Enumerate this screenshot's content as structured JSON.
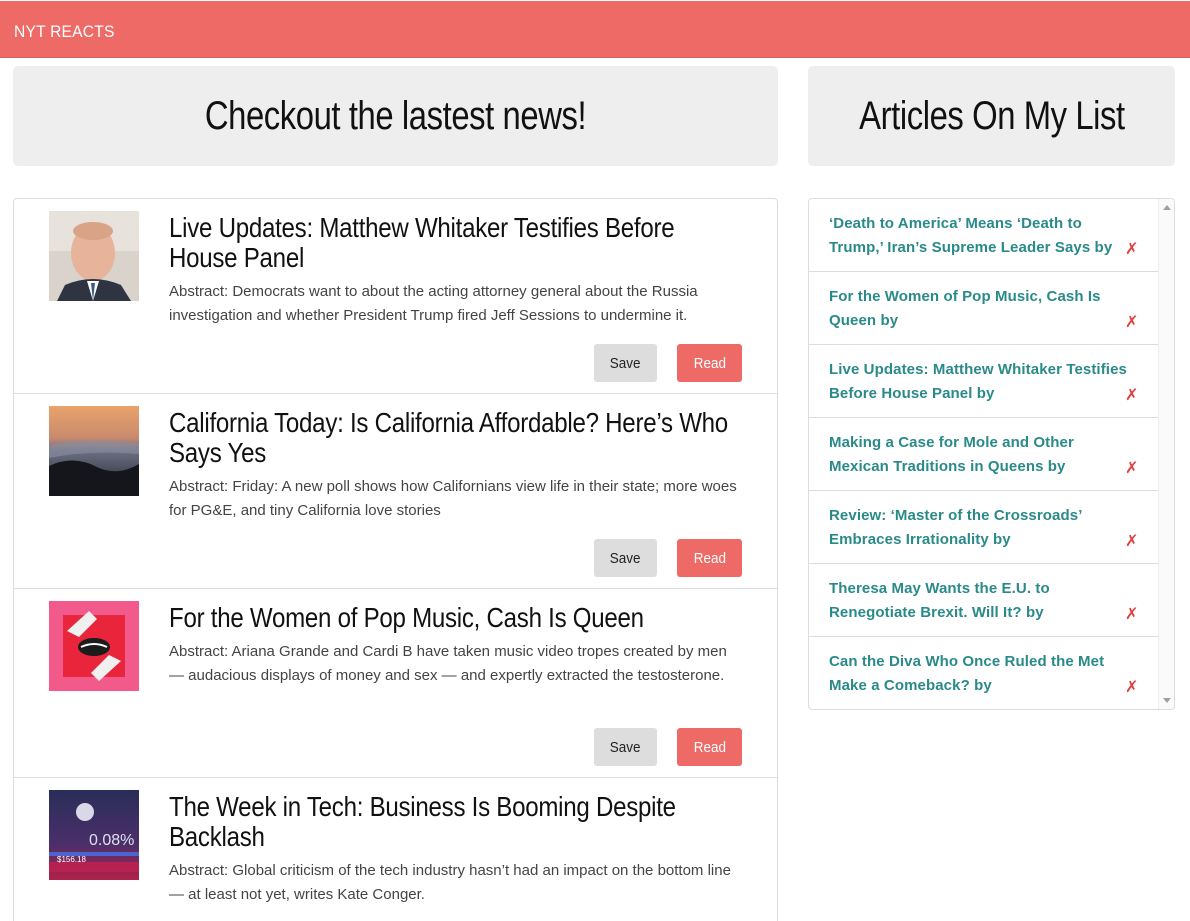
{
  "navbar": {
    "brand": "NYT REACTS"
  },
  "left_header": "Checkout the lastest news!",
  "right_header": "Articles On My List",
  "articles": [
    {
      "title": "Live Updates: Matthew Whitaker Testifies Before House Panel",
      "abstract": "Abstract: Democrats want to about the acting attorney general about the Russia investigation and whether President Trump fired Jeff Sessions to undermine it.",
      "save_label": "Save",
      "read_label": "Read"
    },
    {
      "title": "California Today: Is California Affordable? Here’s Who Says Yes",
      "abstract": "Abstract: Friday: A new poll shows how Californians view life in their state; more woes for PG&E, and tiny California love stories",
      "save_label": "Save",
      "read_label": "Read"
    },
    {
      "title": "For the Women of Pop Music, Cash Is Queen",
      "abstract": "Abstract: Ariana Grande and Cardi B have taken music video tropes created by men — audacious displays of money and sex — and expertly extracted the testosterone.",
      "save_label": "Save",
      "read_label": "Read"
    },
    {
      "title": "The Week in Tech: Business Is Booming Despite Backlash",
      "abstract": "Abstract: Global criticism of the tech industry hasn’t had an impact on the bottom line — at least not yet, writes Kate Conger.",
      "thumb_text": "0.08%",
      "thumb_text2": "$156.18"
    }
  ],
  "saved": [
    {
      "title": "‘Death to America’ Means ‘Death to Trump,’ Iran’s Supreme Leader Says by",
      "delete": "✗"
    },
    {
      "title": "For the Women of Pop Music, Cash Is Queen by",
      "delete": "✗"
    },
    {
      "title": "Live Updates: Matthew Whitaker Testifies Before House Panel by",
      "delete": "✗"
    },
    {
      "title": "Making a Case for Mole and Other Mexican Traditions in Queens by",
      "delete": "✗"
    },
    {
      "title": "Review: ‘Master of the Crossroads’ Embraces Irrationality by",
      "delete": "✗"
    },
    {
      "title": "Theresa May Wants the E.U. to Renegotiate Brexit. Will It? by",
      "delete": "✗"
    },
    {
      "title": "Can the Diva Who Once Ruled the Met Make a Comeback? by",
      "delete": "✗"
    }
  ]
}
